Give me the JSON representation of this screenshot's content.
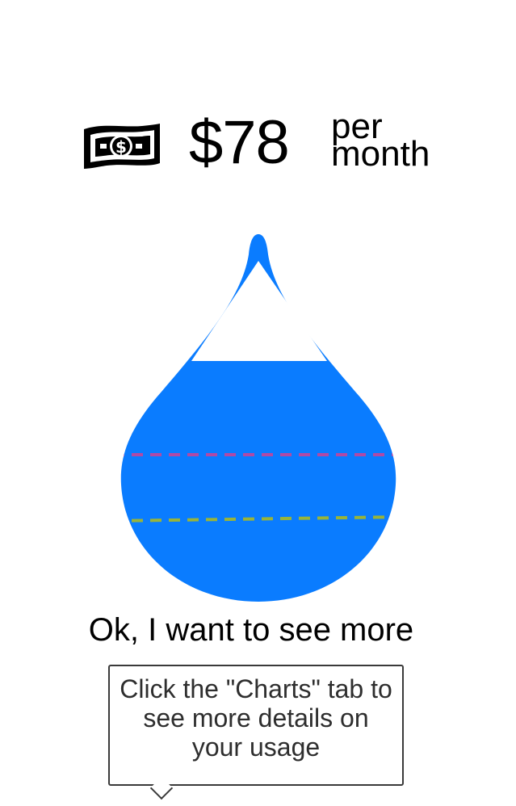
{
  "cost": {
    "amount": "$78",
    "unit_line1": "per",
    "unit_line2": "month",
    "icon": "dollar-bill-icon"
  },
  "water_drop": {
    "icon": "water-drop-icon",
    "fill_color": "#0a7cff",
    "marker_colors": [
      "#b04aa6",
      "#98b43a"
    ]
  },
  "see_more": {
    "label": "Ok, I want to see more"
  },
  "tooltip": {
    "text": "Click the \"Charts\" tab to see more details on your usage"
  }
}
